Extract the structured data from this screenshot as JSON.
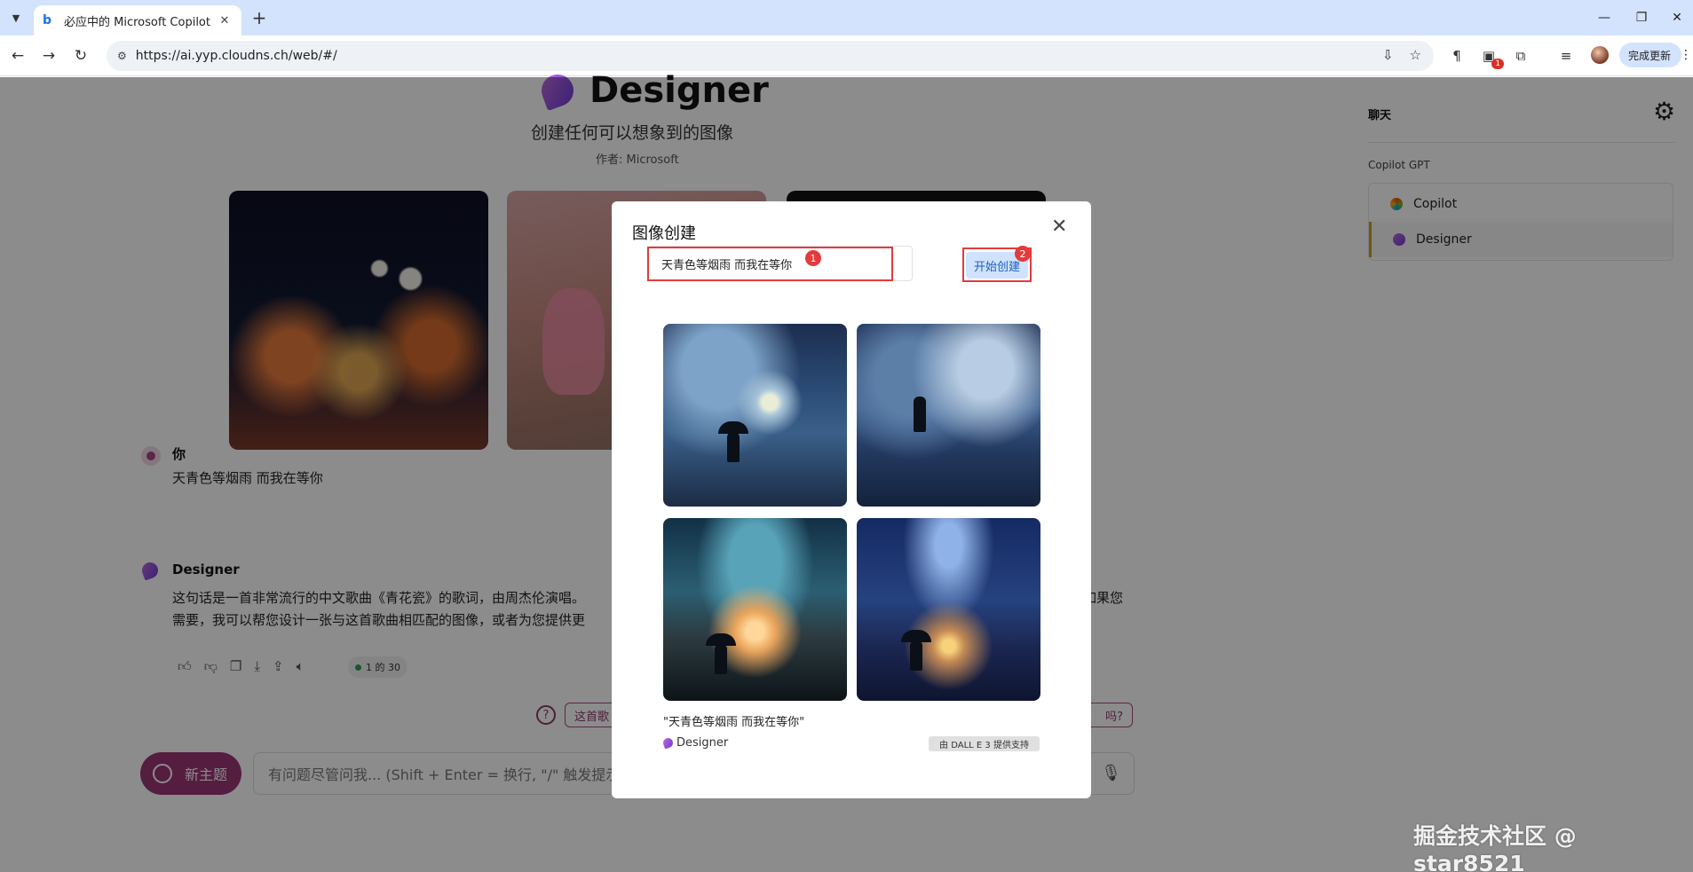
{
  "browser": {
    "tab_title": "必应中的 Microsoft Copilot",
    "url": "https://ai.yyp.cloudns.ch/web/#/",
    "update_label": "完成更新",
    "extension_badge": "1"
  },
  "designer": {
    "title": "Designer",
    "subtitle": "创建任何可以想象到的图像",
    "author": "作者: Microsoft"
  },
  "chat": {
    "user_name": "你",
    "user_message": "天青色等烟雨 而我在等你",
    "bot_name": "Designer",
    "bot_line1": "这句话是一首非常流行的中文歌曲《青花瓷》的歌词，由周杰伦演唱。",
    "bot_line1_tail": "如果您",
    "bot_line2": "需要，我可以帮您设计一张与这首歌曲相匹配的图像，或者为您提供更",
    "page_count": "1 的 30",
    "suggest_1": "这首歌",
    "suggest_3": "吗?"
  },
  "composer": {
    "new_topic": "新主题",
    "placeholder": "有问题尽管问我... (Shift + Enter = 换行, \"/\" 触发提示词)"
  },
  "right_panel": {
    "title": "聊天",
    "section": "Copilot GPT",
    "items": [
      {
        "label": "Copilot"
      },
      {
        "label": "Designer"
      }
    ]
  },
  "modal": {
    "title": "图像创建",
    "prompt_value": "天青色等烟雨 而我在等你",
    "create_label": "开始创建",
    "badge_1": "1",
    "badge_2": "2",
    "caption": "\"天青色等烟雨 而我在等你\"",
    "brand": "Designer",
    "powered_by": "由 DALL E 3 提供支持"
  },
  "watermark": "掘金技术社区 @ star8521",
  "colors": {
    "accent": "#9b3576",
    "highlight_frame": "#e23b3b",
    "create_button": "#cfe2ff"
  }
}
